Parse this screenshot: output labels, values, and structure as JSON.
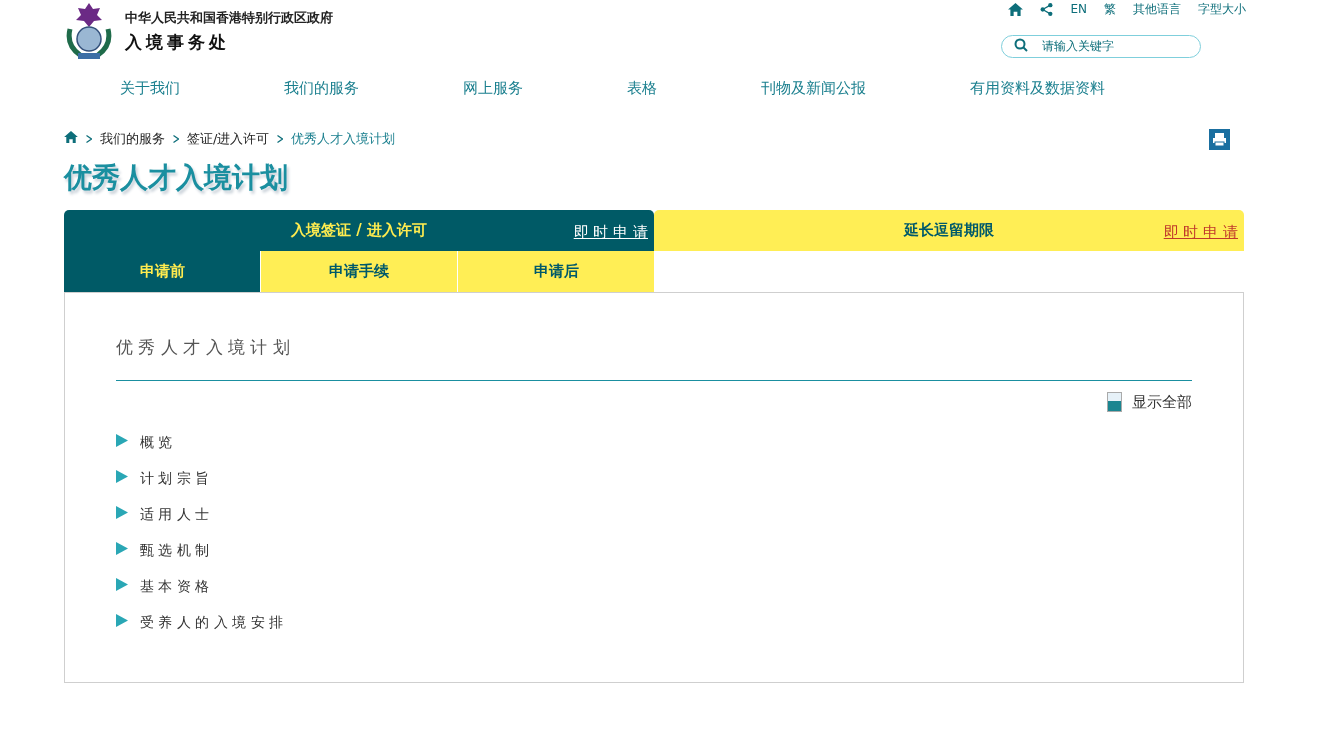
{
  "header": {
    "government": "中华人民共和国香港特别行政区政府",
    "department": "入境事务处"
  },
  "top_links": [
    "EN",
    "繁",
    "其他语言",
    "字型大小"
  ],
  "search": {
    "placeholder": "请输入关键字"
  },
  "nav": [
    "关于我们",
    "我们的服务",
    "网上服务",
    "表格",
    "刊物及新闻公报",
    "有用资料及数据资料"
  ],
  "breadcrumb": [
    "我们的服务",
    "签证/进入许可",
    "优秀人才入境计划"
  ],
  "page_title": "优秀人才入境计划",
  "main_tabs": [
    {
      "label": "入境签证 / 进入许可",
      "link": "即 时 申 请",
      "selected": true
    },
    {
      "label": "延长逗留期限",
      "link": "即 时 申 请",
      "selected": false
    }
  ],
  "sub_tabs": [
    {
      "label": "申请前",
      "selected": true
    },
    {
      "label": "申请手续",
      "selected": false
    },
    {
      "label": "申请后",
      "selected": false
    }
  ],
  "section_title": "优 秀 人 才 入 境 计 划",
  "show_all": "显示全部",
  "sections": [
    {
      "label": "概 览",
      "expanded": false
    },
    {
      "label": "计 划 宗 旨",
      "expanded": false
    },
    {
      "label": "适 用 人 士",
      "expanded": false
    },
    {
      "label": "甄 选 机 制",
      "expanded": false
    },
    {
      "label": "基 本 资 格",
      "expanded": false
    },
    {
      "label": "受 养 人 的 入 境 安 排",
      "expanded": false
    }
  ]
}
